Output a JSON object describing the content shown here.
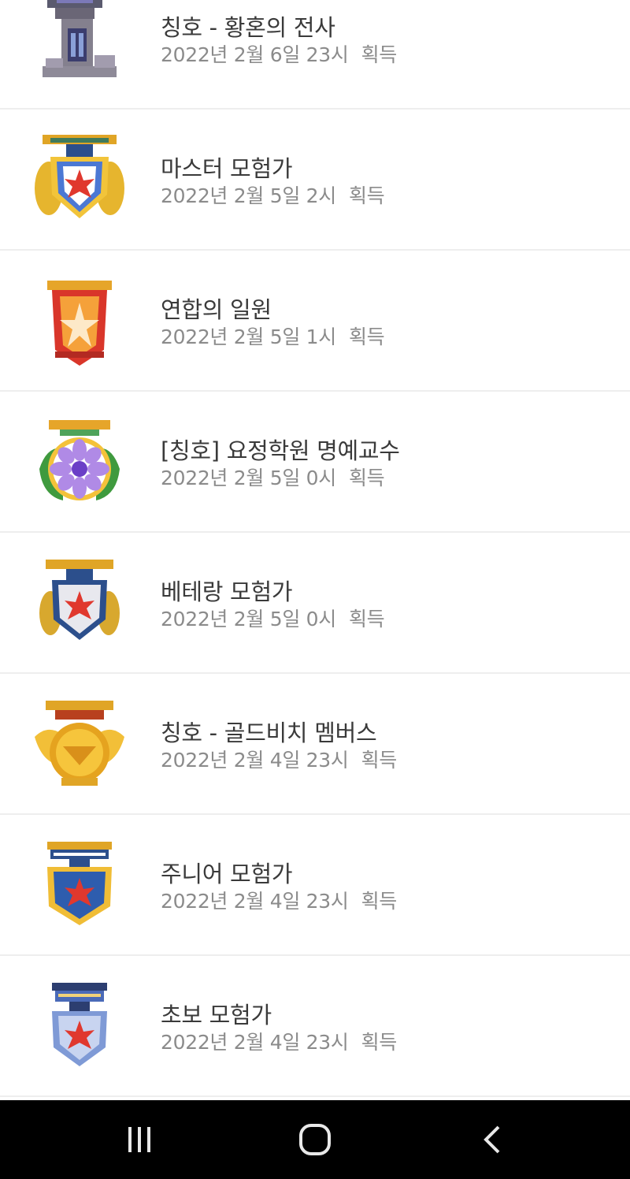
{
  "items": [
    {
      "title": "칭호 - 황혼의 전사",
      "date": "2022년 2월 6일 23시",
      "status": "획득",
      "icon": "tower-title-icon"
    },
    {
      "title": "마스터 모험가",
      "date": "2022년 2월 5일 2시",
      "status": "획득",
      "icon": "master-adventurer-medal-icon"
    },
    {
      "title": "연합의 일원",
      "date": "2022년 2월 5일 1시",
      "status": "획득",
      "icon": "union-member-medal-icon"
    },
    {
      "title": "[칭호] 요정학원 명예교수",
      "date": "2022년 2월 5일 0시",
      "status": "획득",
      "icon": "flower-medal-icon"
    },
    {
      "title": "베테랑 모험가",
      "date": "2022년 2월 5일 0시",
      "status": "획득",
      "icon": "veteran-adventurer-medal-icon"
    },
    {
      "title": "칭호 - 골드비치 멤버스",
      "date": "2022년 2월 4일 23시",
      "status": "획득",
      "icon": "gold-beach-medal-icon"
    },
    {
      "title": "주니어 모험가",
      "date": "2022년 2월 4일 23시",
      "status": "획득",
      "icon": "junior-adventurer-medal-icon"
    },
    {
      "title": "초보 모험가",
      "date": "2022년 2월 4일 23시",
      "status": "획득",
      "icon": "beginner-adventurer-medal-icon"
    }
  ],
  "navbar": {
    "recent_apps": "recent-apps-icon",
    "home": "home-icon",
    "back": "back-icon"
  },
  "colors": {
    "title_text": "#3a3a3a",
    "meta_text": "#8b8b8b",
    "divider": "#eeeeee",
    "navbar_bg": "#000000"
  }
}
